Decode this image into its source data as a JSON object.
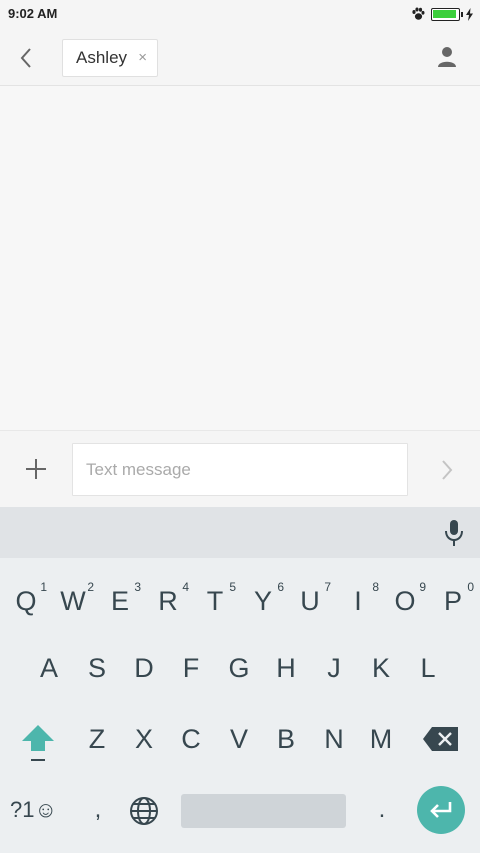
{
  "status_bar": {
    "time": "9:02 AM",
    "icons": [
      "paw-icon",
      "battery-icon",
      "charging-bolt-icon"
    ],
    "battery_color": "#3ccf3c"
  },
  "header": {
    "back_icon": "chevron-left-icon",
    "recipient": "Ashley",
    "chip_close": "×",
    "contact_icon": "person-icon"
  },
  "compose": {
    "attach_icon": "plus-icon",
    "placeholder": "Text message",
    "value": "",
    "send_icon": "chevron-right-icon"
  },
  "keyboard": {
    "accent_color": "#4db6ac",
    "row1": [
      {
        "key": "Q",
        "hint": "1"
      },
      {
        "key": "W",
        "hint": "2"
      },
      {
        "key": "E",
        "hint": "3"
      },
      {
        "key": "R",
        "hint": "4"
      },
      {
        "key": "T",
        "hint": "5"
      },
      {
        "key": "Y",
        "hint": "6"
      },
      {
        "key": "U",
        "hint": "7"
      },
      {
        "key": "I",
        "hint": "8"
      },
      {
        "key": "O",
        "hint": "9"
      },
      {
        "key": "P",
        "hint": "0"
      }
    ],
    "row2": [
      "A",
      "S",
      "D",
      "F",
      "G",
      "H",
      "J",
      "K",
      "L"
    ],
    "row3": [
      "Z",
      "X",
      "C",
      "V",
      "B",
      "N",
      "M"
    ],
    "symbols_label": "?1☺",
    "comma": ",",
    "period": ".",
    "mic_icon": "microphone-icon",
    "shift_icon": "shift-arrow-icon",
    "backspace_icon": "backspace-icon",
    "globe_icon": "globe-icon",
    "enter_icon": "enter-arrow-icon"
  }
}
